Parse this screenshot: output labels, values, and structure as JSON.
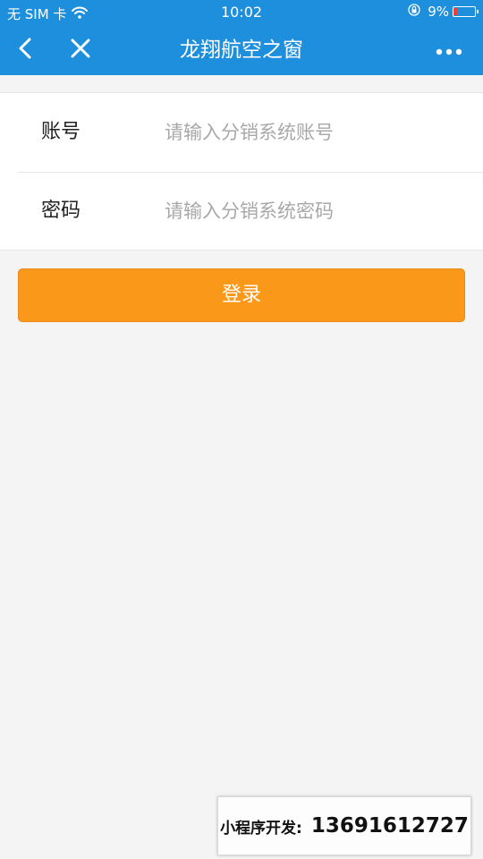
{
  "status_bar": {
    "carrier": "无 SIM 卡",
    "time": "10:02",
    "battery_percent": "9%",
    "battery_level": 0.09,
    "battery_color": "#ff3b30",
    "icons": [
      "wifi-icon",
      "lock-rotation-icon",
      "battery-icon"
    ]
  },
  "navbar": {
    "title": "龙翔航空之窗",
    "background": "#1e8fdc",
    "icons": [
      "chevron-left-icon",
      "close-icon",
      "more-dots-icon"
    ]
  },
  "form": {
    "account": {
      "label": "账号",
      "placeholder": "请输入分销系统账号",
      "value": ""
    },
    "password": {
      "label": "密码",
      "placeholder": "请输入分销系统密码",
      "value": ""
    }
  },
  "login_button": {
    "label": "登录",
    "color": "#fa981a"
  },
  "watermark": {
    "label": "小程序开发:",
    "phone": "13691612727"
  }
}
